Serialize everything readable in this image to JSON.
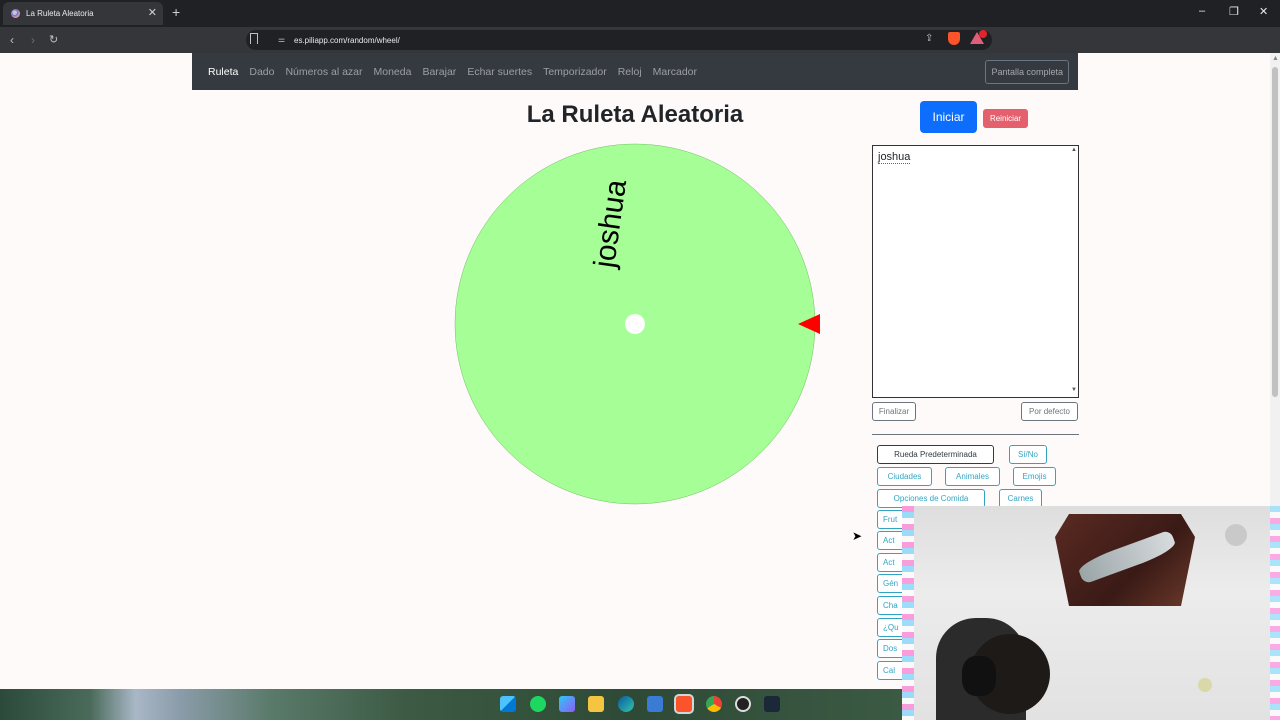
{
  "browser": {
    "tab_title": "La Ruleta Aleatoria",
    "tab_close": "✕",
    "new_tab": "+",
    "url": "es.piliapp.com/random/wheel/",
    "window_controls": [
      "–",
      "❐",
      "✕"
    ]
  },
  "site_nav": {
    "items": [
      "Ruleta",
      "Dado",
      "Números al azar",
      "Moneda",
      "Barajar",
      "Echar suertes",
      "Temporizador",
      "Reloj",
      "Marcador"
    ],
    "active_index": 0,
    "fullscreen_label": "Pantalla completa"
  },
  "main": {
    "title": "La Ruleta Aleatoria",
    "start_label": "Iniciar",
    "reset_label": "Reiniciar",
    "wheel_label": "joshua",
    "wheel_color": "#a6fe97",
    "pointer_color": "#ff0000"
  },
  "names": {
    "entries": [
      "joshua"
    ],
    "finish_label": "Finalizar",
    "default_label": "Por defecto"
  },
  "presets": {
    "row1": [
      "Rueda Predeterminada",
      "Sí/No"
    ],
    "row2": [
      "Ciudades",
      "Animales",
      "Emojis"
    ],
    "row3": [
      "Opciones de Comida",
      "Carnes"
    ],
    "clipped": [
      "Frut",
      "Act",
      "Act",
      "Gén",
      "Cha",
      "¿Qu",
      "Dos",
      "Cal"
    ]
  },
  "icons": {
    "back": "back-arrow-icon",
    "forward": "forward-arrow-icon",
    "reload": "reload-icon"
  }
}
